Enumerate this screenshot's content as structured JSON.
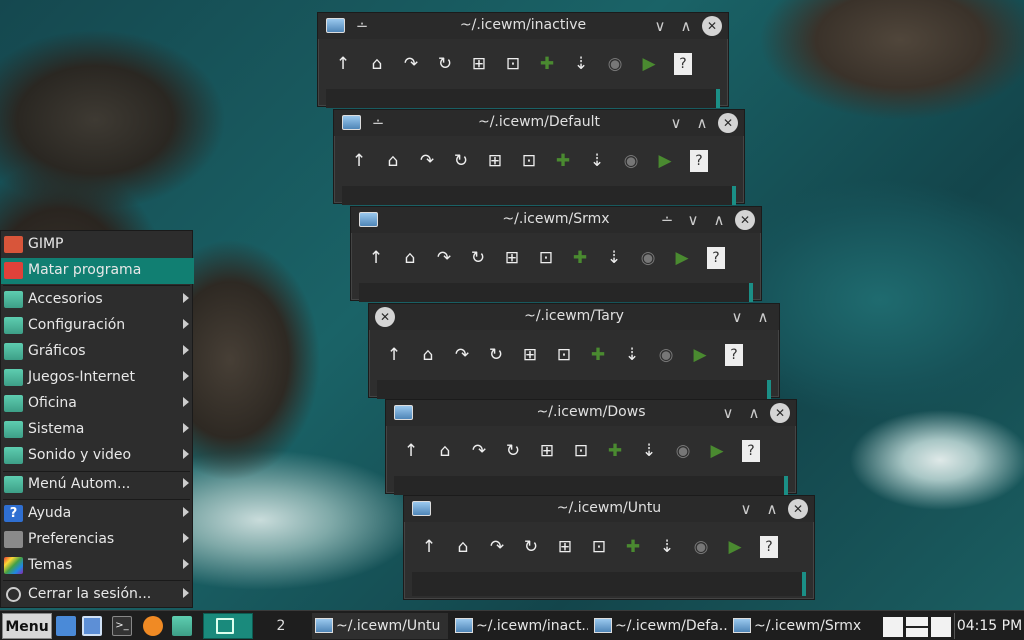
{
  "windows": [
    {
      "title": "~/.icewm/inactive",
      "shade": "∸"
    },
    {
      "title": "~/.icewm/Default",
      "shade": "∸"
    },
    {
      "title": "~/.icewm/Srmx",
      "shade": "∸"
    },
    {
      "title": "~/.icewm/Tary",
      "shade": ""
    },
    {
      "title": "~/.icewm/Dows",
      "shade": ""
    },
    {
      "title": "~/.icewm/Untu",
      "shade": ""
    }
  ],
  "toolbar_glyphs": {
    "up": "↑",
    "home": "⌂",
    "back": "↷",
    "reload": "↻",
    "zoom_in": "⊞",
    "zoom_out": "⊡",
    "add": "✚",
    "sort": "⇣",
    "eye": "◉",
    "terminal": "▶",
    "help": "?"
  },
  "controls": {
    "minimize": "∨",
    "maximize": "∧",
    "close": "✕"
  },
  "menu": {
    "items": [
      {
        "label": "GIMP",
        "submenu": false
      },
      {
        "label": "Matar programa",
        "submenu": false
      },
      {
        "label": "Accesorios",
        "submenu": true
      },
      {
        "label": "Configuración",
        "submenu": true
      },
      {
        "label": "Gráficos",
        "submenu": true
      },
      {
        "label": "Juegos-Internet",
        "submenu": true
      },
      {
        "label": "Oficina",
        "submenu": true
      },
      {
        "label": "Sistema",
        "submenu": true
      },
      {
        "label": "Sonido y video",
        "submenu": true
      },
      {
        "label": "Menú Autom...",
        "submenu": true
      },
      {
        "label": "Ayuda",
        "submenu": true
      },
      {
        "label": "Preferencias",
        "submenu": true
      },
      {
        "label": "Temas",
        "submenu": true
      },
      {
        "label": "Cerrar la sesión...",
        "submenu": true
      }
    ],
    "selected": "Matar programa"
  },
  "taskbar": {
    "menu_label": "Menu",
    "workspace": "2",
    "tasks": [
      "~/.icewm/Untu",
      "~/.icewm/inact...",
      "~/.icewm/Defa...",
      "~/.icewm/Srmx"
    ],
    "clock": "04:15 PM"
  },
  "colors": {
    "accent": "#117f72",
    "titlebar": "#2a2a2a",
    "panel": "#2d2d2d"
  }
}
